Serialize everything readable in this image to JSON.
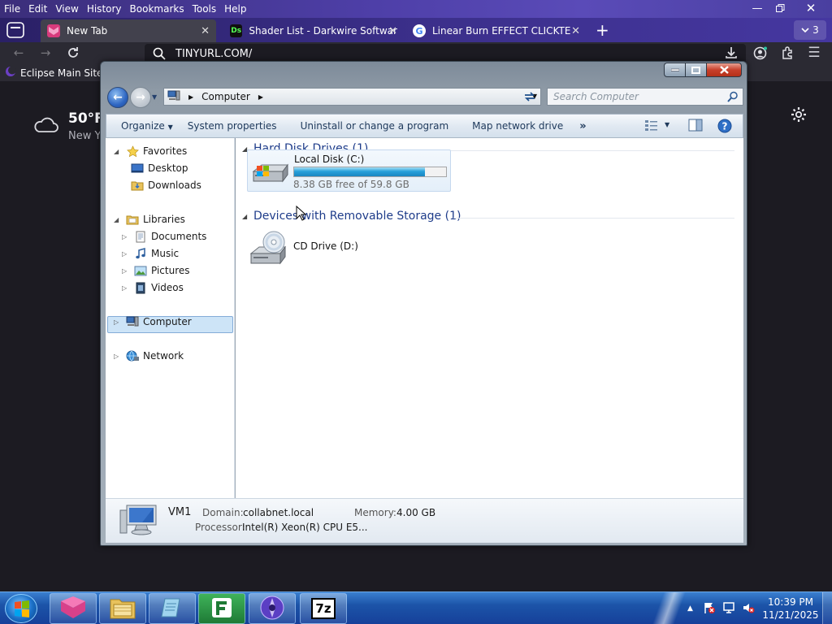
{
  "browser": {
    "menu": [
      {
        "label": "File"
      },
      {
        "label": "Edit"
      },
      {
        "label": "View"
      },
      {
        "label": "History"
      },
      {
        "label": "Bookmarks"
      },
      {
        "label": "Tools"
      },
      {
        "label": "Help"
      }
    ],
    "tab_count": "3",
    "tabs": [
      {
        "label": "New Tab",
        "active": true
      },
      {
        "label": "Shader List - Darkwire Software",
        "active": false
      },
      {
        "label": "Linear Burn EFFECT CLICKTEAM",
        "active": false
      }
    ],
    "url": "TINYURL.COM/",
    "bookmark": "Eclipse Main Site",
    "weather": {
      "temp": "50°F",
      "location": "New Y"
    }
  },
  "explorer": {
    "address": "Computer",
    "search_placeholder": "Search Computer",
    "commands": [
      "Organize",
      "System properties",
      "Uninstall or change a program",
      "Map network drive"
    ],
    "nav": {
      "favorites": "Favorites",
      "desktop": "Desktop",
      "downloads": "Downloads",
      "libraries": "Libraries",
      "documents": "Documents",
      "music": "Music",
      "pictures": "Pictures",
      "videos": "Videos",
      "computer": "Computer",
      "network": "Network"
    },
    "groups": {
      "hdd": "Hard Disk Drives (1)",
      "removable": "Devices with Removable Storage (1)"
    },
    "drive_c": {
      "name": "Local Disk (C:)",
      "free_text": "8.38 GB free of 59.8 GB",
      "used_fraction": 0.86
    },
    "drive_d": {
      "name": "CD Drive (D:)"
    },
    "details": {
      "name": "VM1",
      "domain_label": "Domain:",
      "domain": "collabnet.local",
      "memory_label": "Memory:",
      "memory": "4.00 GB",
      "processor_label": "Processor:",
      "processor": "Intel(R) Xeon(R) CPU E5..."
    }
  },
  "taskbar": {
    "apps": [
      "firefox-nightly",
      "windows-explorer",
      "notepad",
      "fastpictureviewer",
      "eclipse",
      "7-zip"
    ],
    "app_7zip_label": "7z",
    "time": "10:39 PM",
    "date": "11/21/2025"
  }
}
